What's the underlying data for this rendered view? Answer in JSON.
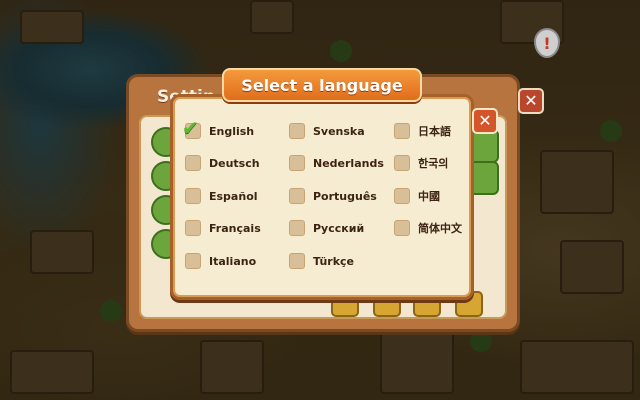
{
  "dialog": {
    "title": "Select a language",
    "close_icon": "close-icon"
  },
  "settings": {
    "title_fragment": "Settin"
  },
  "languages": [
    {
      "label": "English",
      "selected": true
    },
    {
      "label": "Svenska",
      "selected": false
    },
    {
      "label": "日本語",
      "selected": false
    },
    {
      "label": "Deutsch",
      "selected": false
    },
    {
      "label": "Nederlands",
      "selected": false
    },
    {
      "label": "한국의",
      "selected": false
    },
    {
      "label": "Español",
      "selected": false
    },
    {
      "label": "Português",
      "selected": false
    },
    {
      "label": "中國",
      "selected": false
    },
    {
      "label": "Français",
      "selected": false
    },
    {
      "label": "Русский",
      "selected": false
    },
    {
      "label": "简体中文",
      "selected": false
    },
    {
      "label": "Italiano",
      "selected": false
    },
    {
      "label": "Türkçe",
      "selected": false
    }
  ],
  "alert_marker": "!",
  "colors": {
    "banner": "#e16d1c",
    "check": "#5cb82c",
    "close": "#d4552a"
  }
}
